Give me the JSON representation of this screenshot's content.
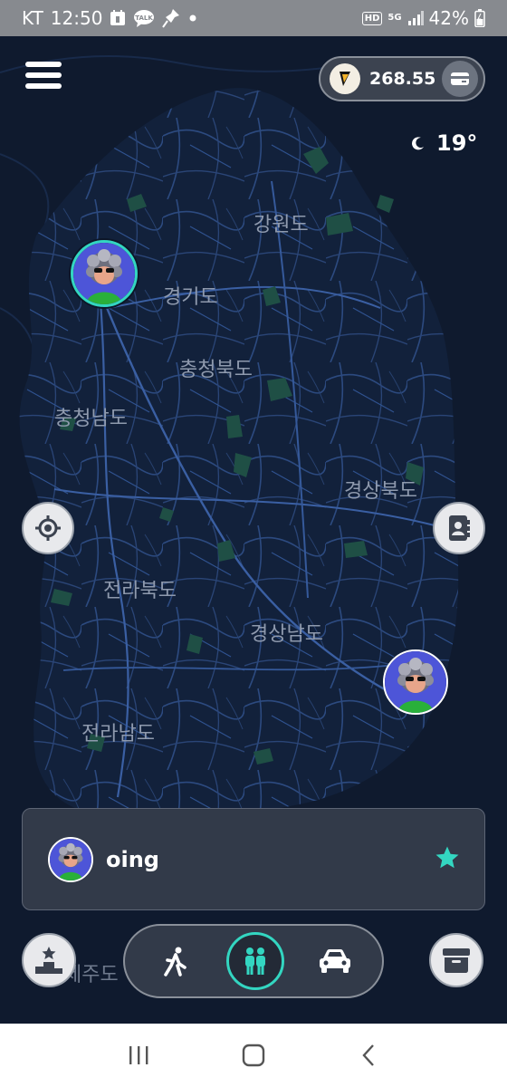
{
  "status_bar": {
    "carrier": "KT",
    "time": "12:50",
    "notification_icons": [
      "calendar-icon",
      "kakaotalk-icon",
      "pin-app-icon",
      "dot-icon"
    ],
    "talk_badge": "TALK",
    "hd_label": "HD",
    "network_label": "5G",
    "battery": "42%"
  },
  "header": {
    "balance": "268.55",
    "temperature": "19°",
    "weather_icon": "moon-icon"
  },
  "map": {
    "regions": [
      "강원도",
      "경기도",
      "충청북도",
      "충청남도",
      "경상북도",
      "전라북도",
      "경상남도",
      "전라남도",
      "제주도"
    ]
  },
  "friend_card": {
    "name": "oing",
    "favorite": true
  },
  "modes": {
    "items": [
      "walk-icon",
      "friends-icon",
      "car-icon"
    ],
    "selected": "friends"
  },
  "colors": {
    "accent": "#33d6c1",
    "map_background": "#0f1a2e",
    "road": "#2f4f86",
    "park": "#1f4f45",
    "card": "#323a49"
  }
}
